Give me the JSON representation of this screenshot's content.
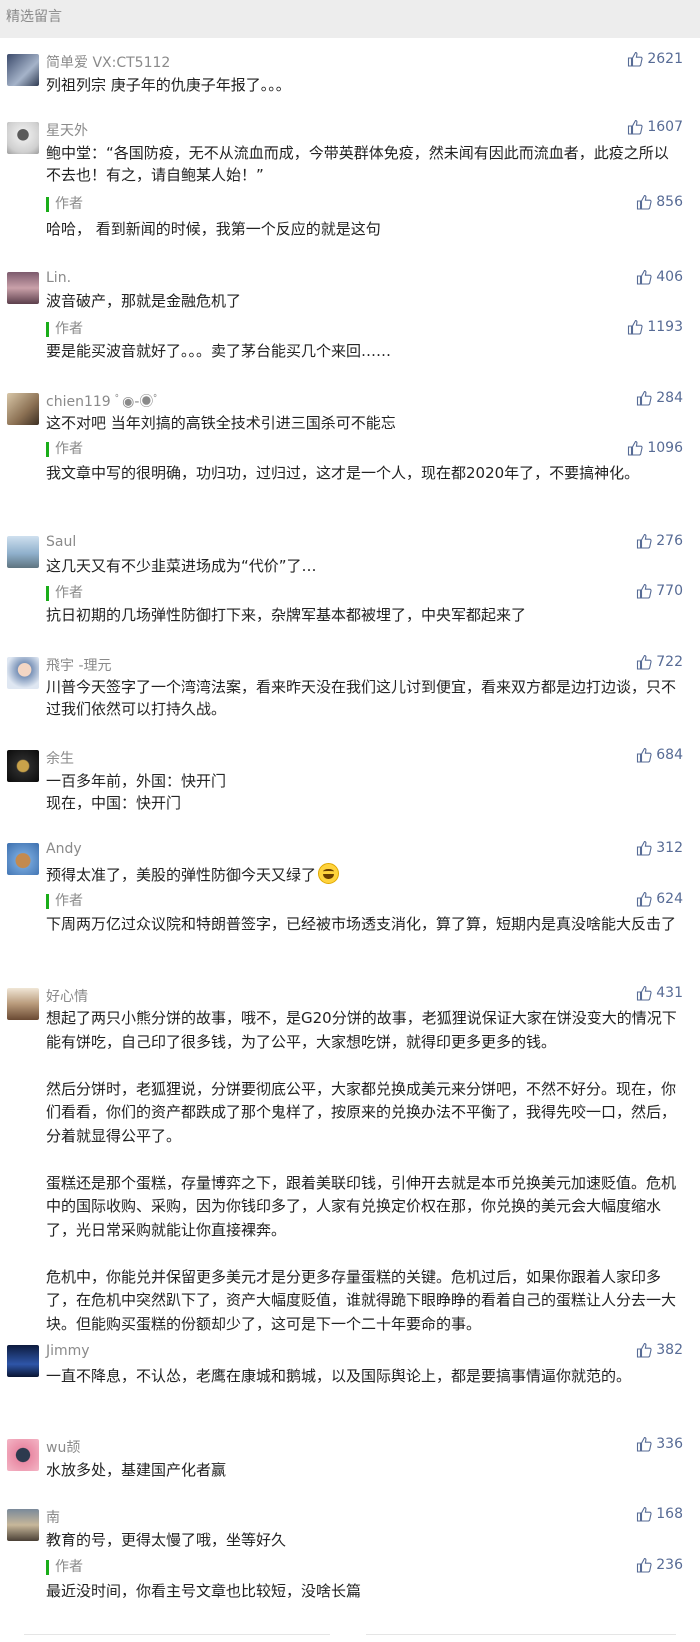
{
  "section_title": "精选留言",
  "colors": {
    "like": "#576b95",
    "author_bar": "#1aad19",
    "name": "#8a8a8a"
  },
  "icons": {
    "like": "thumbs-up-icon"
  },
  "comments": [
    {
      "nickname": "简单爱 VX:CT5112",
      "likes": "2621",
      "text": "列祖列宗 庚子年的仇庚子年报了。。。"
    },
    {
      "nickname": "星天外",
      "likes": "1607",
      "text": "鲍中堂：“各国防疫，无不从流血而成，今带英群体免疫，然未闻有因此而流血者，此疫之所以不去也！有之，请自鲍某人始！”",
      "reply": {
        "label": "作者",
        "likes": "856",
        "text": "哈哈， 看到新闻的时候，我第一个反应的就是这句"
      }
    },
    {
      "nickname": "Lin.",
      "likes": "406",
      "text": "波音破产，那就是金融危机了",
      "reply": {
        "label": "作者",
        "likes": "1193",
        "text": "要是能买波音就好了。。。卖了茅台能买几个来回……"
      }
    },
    {
      "nickname": "chien119 ﾟ◉-◉ﾟ",
      "likes": "284",
      "text": "这不对吧 当年刘搞的高铁全技术引进三国杀可不能忘",
      "reply": {
        "label": "作者",
        "likes": "1096",
        "text": "我文章中写的很明确，功归功，过归过，这才是一个人，现在都2020年了，不要搞神化。"
      }
    },
    {
      "nickname": "Saul",
      "likes": "276",
      "text": "这几天又有不少韭菜进场成为“代价”了…",
      "reply": {
        "label": "作者",
        "likes": "770",
        "text": "抗日初期的几场弹性防御打下来，杂牌军基本都被埋了，中央军都起来了"
      }
    },
    {
      "nickname": "飛宇 -理元",
      "likes": "722",
      "text": "川普今天签字了一个湾湾法案，看来昨天没在我们这儿讨到便宜，看来双方都是边打边谈，只不过我们依然可以打持久战。"
    },
    {
      "nickname": "余生",
      "likes": "684",
      "text": "一百多年前，外国：快开门\n现在，中国：快开门"
    },
    {
      "nickname": "Andy",
      "likes": "312",
      "text": "预得太准了，美股的弹性防御今天又绿了",
      "reply": {
        "label": "作者",
        "likes": "624",
        "text": "下周两万亿过众议院和特朗普签字，已经被市场透支消化，算了算，短期内是真没啥能大反击了"
      }
    },
    {
      "nickname": "好心情",
      "likes": "431",
      "text": "想起了两只小熊分饼的故事，哦不，是G20分饼的故事，老狐狸说保证大家在饼没变大的情况下能有饼吃，自己印了很多钱，为了公平，大家想吃饼，就得印更多更多的钱。\n\n然后分饼时，老狐狸说，分饼要彻底公平，大家都兑换成美元来分饼吧，不然不好分。现在，你们看看，你们的资产都跌成了那个鬼样了，按原来的兑换办法不平衡了，我得先咬一口，然后，分着就显得公平了。\n\n蛋糕还是那个蛋糕，存量博弈之下，跟着美联印钱，引伸开去就是本币兑换美元加速贬值。危机中的国际收购、采购，因为你钱印多了，人家有兑换定价权在那，你兑换的美元会大幅度缩水了，光日常采购就能让你直接裸奔。\n\n危机中，你能兑并保留更多美元才是分更多存量蛋糕的关键。危机过后，如果你跟着人家印多了，在危机中突然趴下了，资产大幅度贬值，谁就得跪下眼睁睁的看着自己的蛋糕让人分去一大块。但能购买蛋糕的份额却少了，这可是下一个二十年要命的事。"
    },
    {
      "nickname": "Jimmy",
      "likes": "382",
      "text": "一直不降息，不认怂，老鹰在康城和鹅城，以及国际舆论上，都是要搞事情逼你就范的。"
    },
    {
      "nickname": "wu颉",
      "likes": "336",
      "text": "水放多处，基建国产化者赢"
    },
    {
      "nickname": "南",
      "likes": "168",
      "text": "教育的号，更得太慢了哦，坐等好久",
      "reply": {
        "label": "作者",
        "likes": "236",
        "text": "最近没时间，你看主号文章也比较短，没啥长篇"
      }
    }
  ]
}
